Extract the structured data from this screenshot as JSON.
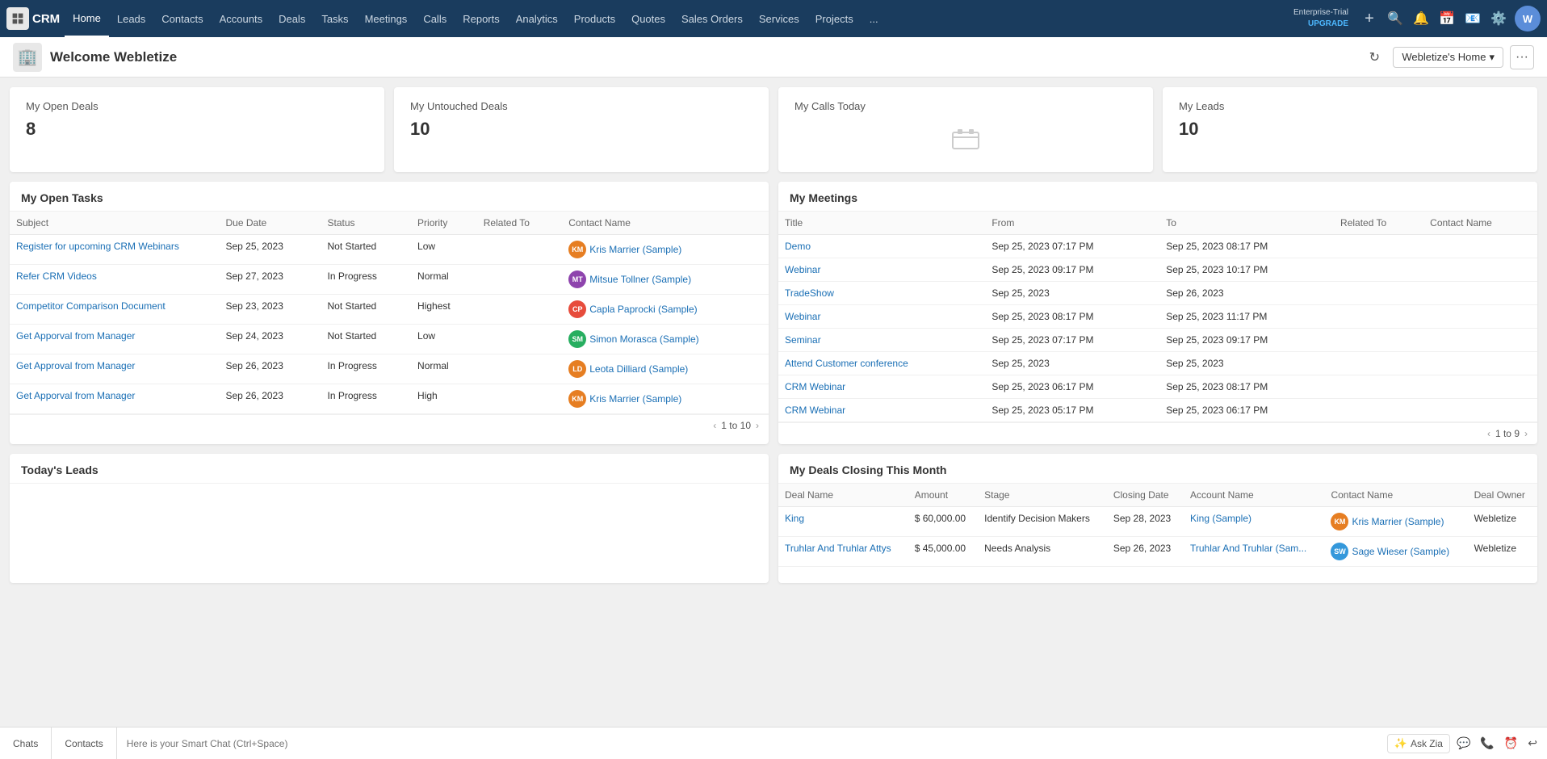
{
  "app": {
    "logo_text": "CRM",
    "nav_items": [
      "Home",
      "Leads",
      "Contacts",
      "Accounts",
      "Deals",
      "Tasks",
      "Meetings",
      "Calls",
      "Reports",
      "Analytics",
      "Products",
      "Quotes",
      "Sales Orders",
      "Services",
      "Projects",
      "..."
    ],
    "enterprise_label": "Enterprise-Trial",
    "upgrade_label": "UPGRADE",
    "home_dropdown": "Webletize's Home"
  },
  "header": {
    "welcome": "Welcome Webletize",
    "refresh_title": "Refresh"
  },
  "stats": [
    {
      "label": "My Open Deals",
      "value": "8"
    },
    {
      "label": "My Untouched Deals",
      "value": "10"
    },
    {
      "label": "My Calls Today",
      "value": ""
    },
    {
      "label": "My Leads",
      "value": "10"
    }
  ],
  "open_tasks": {
    "title": "My Open Tasks",
    "columns": [
      "Subject",
      "Due Date",
      "Status",
      "Priority",
      "Related To",
      "Contact Name"
    ],
    "rows": [
      {
        "subject": "Register for upcoming CRM Webinars",
        "due_date": "Sep 25, 2023",
        "status": "Not Started",
        "priority": "Low",
        "related_to": "",
        "contact_name": "Kris Marrier (Sample)",
        "avatar_color": "#e67e22",
        "avatar_initials": "KM"
      },
      {
        "subject": "Refer CRM Videos",
        "due_date": "Sep 27, 2023",
        "status": "In Progress",
        "priority": "Normal",
        "related_to": "",
        "contact_name": "Mitsue Tollner (Sample)",
        "avatar_color": "#8e44ad",
        "avatar_initials": "MT"
      },
      {
        "subject": "Competitor Comparison Document",
        "due_date": "Sep 23, 2023",
        "status": "Not Started",
        "priority": "Highest",
        "related_to": "",
        "contact_name": "Capla Paprocki (Sample)",
        "avatar_color": "#e74c3c",
        "avatar_initials": "CP"
      },
      {
        "subject": "Get Apporval from Manager",
        "due_date": "Sep 24, 2023",
        "status": "Not Started",
        "priority": "Low",
        "related_to": "",
        "contact_name": "Simon Morasca (Sample)",
        "avatar_color": "#27ae60",
        "avatar_initials": "SM"
      },
      {
        "subject": "Get Approval from Manager",
        "due_date": "Sep 26, 2023",
        "status": "In Progress",
        "priority": "Normal",
        "related_to": "",
        "contact_name": "Leota Dilliard (Sample)",
        "avatar_color": "#e67e22",
        "avatar_initials": "LD"
      },
      {
        "subject": "Get Apporval from Manager",
        "due_date": "Sep 26, 2023",
        "status": "In Progress",
        "priority": "High",
        "related_to": "",
        "contact_name": "Kris Marrier (Sample)",
        "avatar_color": "#e67e22",
        "avatar_initials": "KM"
      }
    ],
    "pagination": "1 to 10"
  },
  "meetings": {
    "title": "My Meetings",
    "columns": [
      "Title",
      "From",
      "To",
      "Related To",
      "Contact Name"
    ],
    "rows": [
      {
        "title": "Demo",
        "from": "Sep 25, 2023 07:17 PM",
        "to": "Sep 25, 2023 08:17 PM",
        "related_to": "",
        "contact_name": ""
      },
      {
        "title": "Webinar",
        "from": "Sep 25, 2023 09:17 PM",
        "to": "Sep 25, 2023 10:17 PM",
        "related_to": "",
        "contact_name": ""
      },
      {
        "title": "TradeShow",
        "from": "Sep 25, 2023",
        "to": "Sep 26, 2023",
        "related_to": "",
        "contact_name": ""
      },
      {
        "title": "Webinar",
        "from": "Sep 25, 2023 08:17 PM",
        "to": "Sep 25, 2023 11:17 PM",
        "related_to": "",
        "contact_name": ""
      },
      {
        "title": "Seminar",
        "from": "Sep 25, 2023 07:17 PM",
        "to": "Sep 25, 2023 09:17 PM",
        "related_to": "",
        "contact_name": ""
      },
      {
        "title": "Attend Customer conference",
        "from": "Sep 25, 2023",
        "to": "Sep 25, 2023",
        "related_to": "",
        "contact_name": ""
      },
      {
        "title": "CRM Webinar",
        "from": "Sep 25, 2023 06:17 PM",
        "to": "Sep 25, 2023 08:17 PM",
        "related_to": "",
        "contact_name": ""
      },
      {
        "title": "CRM Webinar",
        "from": "Sep 25, 2023 05:17 PM",
        "to": "Sep 25, 2023 06:17 PM",
        "related_to": "",
        "contact_name": ""
      }
    ],
    "pagination": "1 to 9"
  },
  "todays_leads": {
    "title": "Today's Leads"
  },
  "deals_closing": {
    "title": "My Deals Closing This Month",
    "columns": [
      "Deal Name",
      "Amount",
      "Stage",
      "Closing Date",
      "Account Name",
      "Contact Name",
      "Deal Owner"
    ],
    "rows": [
      {
        "deal_name": "King",
        "amount": "$ 60,000.00",
        "stage": "Identify Decision Makers",
        "closing_date": "Sep 28, 2023",
        "account_name": "King (Sample)",
        "contact_name": "Kris Marrier (Sample)",
        "deal_owner": "Webletize",
        "avatar_color": "#e67e22",
        "avatar_initials": "KM"
      },
      {
        "deal_name": "Truhlar And Truhlar Attys",
        "amount": "$ 45,000.00",
        "stage": "Needs Analysis",
        "closing_date": "Sep 26, 2023",
        "account_name": "Truhlar And Truhlar (Sam...",
        "contact_name": "Sage Wieser (Sample)",
        "deal_owner": "Webletize",
        "avatar_color": "#3498db",
        "avatar_initials": "SW"
      }
    ]
  },
  "smart_chat": {
    "tabs": [
      "Chats",
      "Contacts"
    ],
    "placeholder": "Here is your Smart Chat (Ctrl+Space)",
    "zia_label": "Ask Zia"
  }
}
